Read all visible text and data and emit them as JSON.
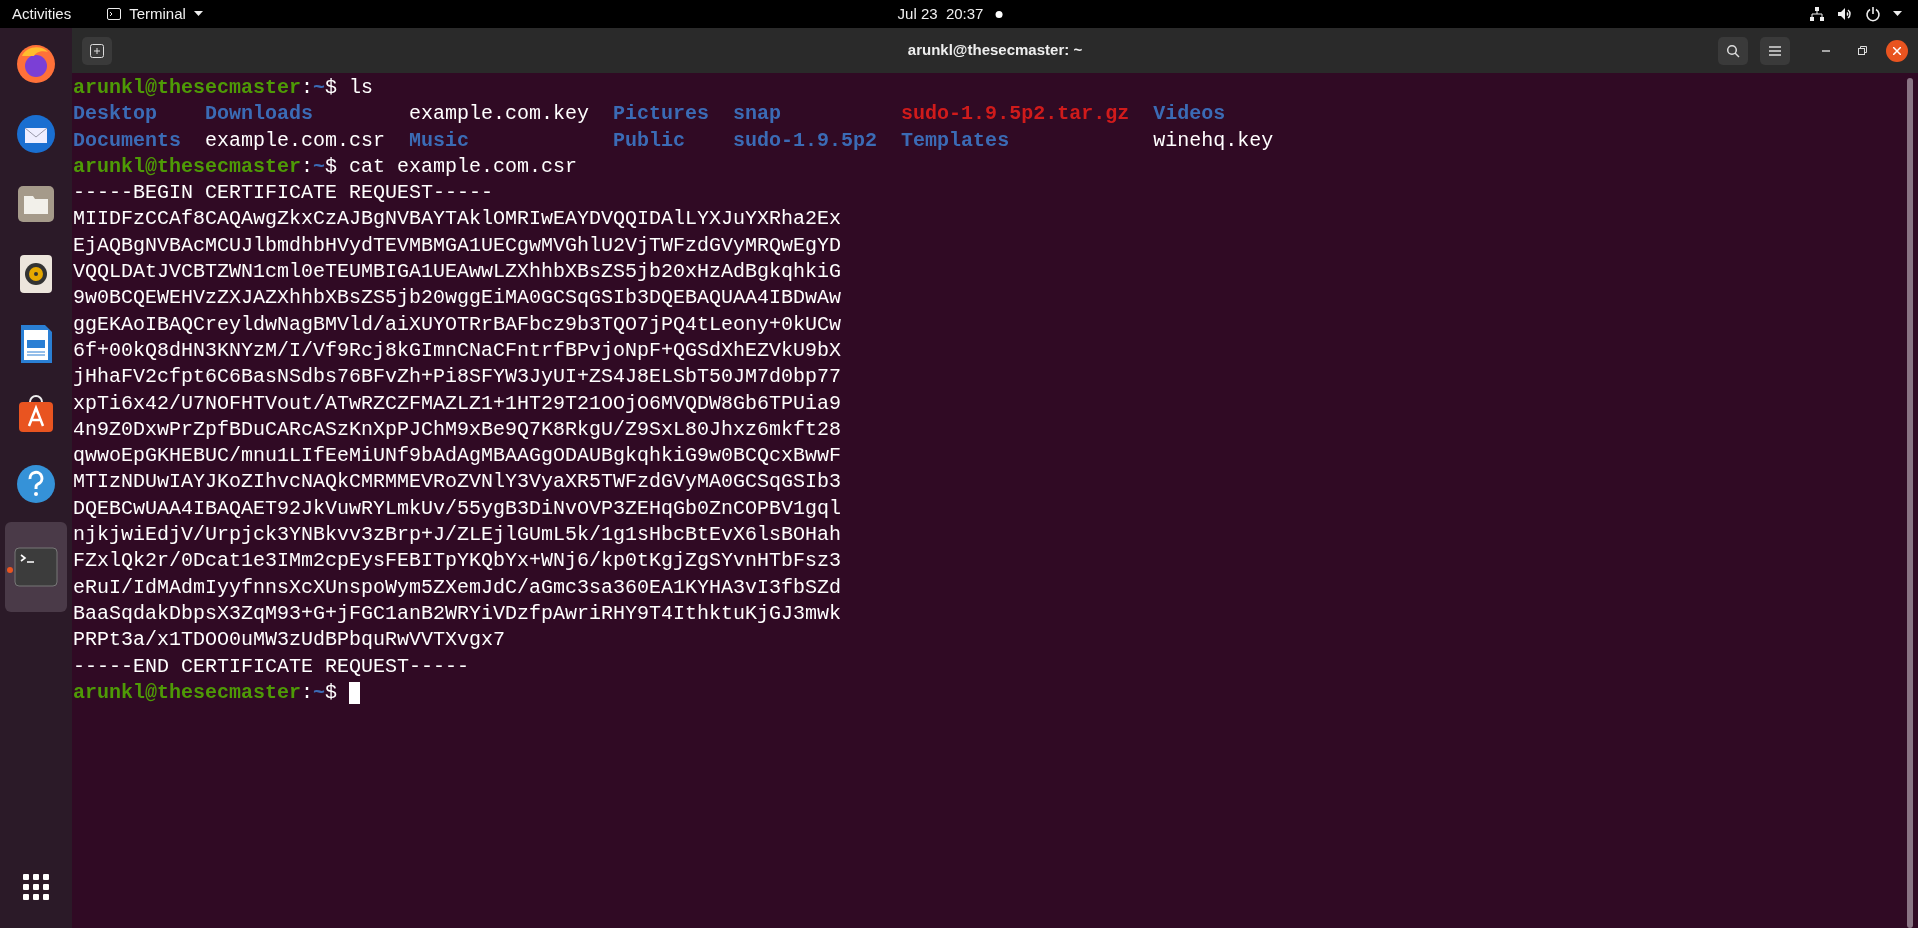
{
  "top_bar": {
    "activities": "Activities",
    "app_menu": "Terminal",
    "clock": "Jul 23  20:37"
  },
  "dock": {
    "items": [
      {
        "kind": "browser",
        "selected": false,
        "running": false
      },
      {
        "kind": "mail",
        "selected": false,
        "running": false
      },
      {
        "kind": "files",
        "selected": false,
        "running": false
      },
      {
        "kind": "music",
        "selected": false,
        "running": false
      },
      {
        "kind": "document",
        "selected": false,
        "running": false
      },
      {
        "kind": "store",
        "selected": false,
        "running": false
      },
      {
        "kind": "help",
        "selected": false,
        "running": false
      },
      {
        "kind": "terminal",
        "selected": true,
        "running": true
      }
    ]
  },
  "window": {
    "title": "arunkl@thesecmaster: ~"
  },
  "terminal": {
    "lines": [
      {
        "kind": "prompt",
        "user": "arunkl@thesecmaster",
        "sep": ":",
        "path": "~",
        "sign": "$",
        "command": "ls"
      },
      {
        "kind": "listing",
        "items": [
          {
            "name": "Desktop",
            "kind": "dir"
          },
          {
            "name": "Downloads",
            "kind": "dir"
          },
          {
            "name": "example.com.key",
            "kind": "file"
          },
          {
            "name": "Pictures",
            "kind": "dir"
          },
          {
            "name": "snap",
            "kind": "dir"
          },
          {
            "name": "sudo-1.9.5p2.tar.gz",
            "kind": "archive"
          },
          {
            "name": "Videos",
            "kind": "dir"
          }
        ]
      },
      {
        "kind": "listing",
        "items": [
          {
            "name": "Documents",
            "kind": "dir"
          },
          {
            "name": "example.com.csr",
            "kind": "file"
          },
          {
            "name": "Music",
            "kind": "dir"
          },
          {
            "name": "Public",
            "kind": "dir"
          },
          {
            "name": "sudo-1.9.5p2",
            "kind": "dir"
          },
          {
            "name": "Templates",
            "kind": "dir"
          },
          {
            "name": "winehq.key",
            "kind": "file"
          }
        ]
      },
      {
        "kind": "prompt",
        "user": "arunkl@thesecmaster",
        "sep": ":",
        "path": "~",
        "sign": "$",
        "command": "cat example.com.csr"
      },
      {
        "kind": "output",
        "text": "-----BEGIN CERTIFICATE REQUEST-----"
      },
      {
        "kind": "output",
        "text": "MIIDFzCCAf8CAQAwgZkxCzAJBgNVBAYTAklOMRIwEAYDVQQIDAlLYXJuYXRha2Ex"
      },
      {
        "kind": "output",
        "text": "EjAQBgNVBAcMCUJlbmdhbHVydTEVMBMGA1UECgwMVGhlU2VjTWFzdGVyMRQwEgYD"
      },
      {
        "kind": "output",
        "text": "VQQLDAtJVCBTZWN1cml0eTEUMBIGA1UEAwwLZXhhbXBsZS5jb20xHzAdBgkqhkiG"
      },
      {
        "kind": "output",
        "text": "9w0BCQEWEHVzZXJAZXhhbXBsZS5jb20wggEiMA0GCSqGSIb3DQEBAQUAA4IBDwAw"
      },
      {
        "kind": "output",
        "text": "ggEKAoIBAQCreyldwNagBMVld/aiXUYOTRrBAFbcz9b3TQO7jPQ4tLeony+0kUCw"
      },
      {
        "kind": "output",
        "text": "6f+00kQ8dHN3KNYzM/I/Vf9Rcj8kGImnCNaCFntrfBPvjoNpF+QGSdXhEZVkU9bX"
      },
      {
        "kind": "output",
        "text": "jHhaFV2cfpt6C6BasNSdbs76BFvZh+Pi8SFYW3JyUI+ZS4J8ELSbT50JM7d0bp77"
      },
      {
        "kind": "output",
        "text": "xpTi6x42/U7NOFHTVout/ATwRZCZFMAZLZ1+1HT29T21OOjO6MVQDW8Gb6TPUia9"
      },
      {
        "kind": "output",
        "text": "4n9Z0DxwPrZpfBDuCARcASzKnXpPJChM9xBe9Q7K8RkgU/Z9SxL80Jhxz6mkft28"
      },
      {
        "kind": "output",
        "text": "qwwoEpGKHEBUC/mnu1LIfEeMiUNf9bAdAgMBAAGgODAUBgkqhkiG9w0BCQcxBwwF"
      },
      {
        "kind": "output",
        "text": "MTIzNDUwIAYJKoZIhvcNAQkCMRMMEVRoZVNlY3VyaXR5TWFzdGVyMA0GCSqGSIb3"
      },
      {
        "kind": "output",
        "text": "DQEBCwUAA4IBAQAET92JkVuwRYLmkUv/55ygB3DiNvOVP3ZEHqGb0ZnCOPBV1gql"
      },
      {
        "kind": "output",
        "text": "njkjwiEdjV/Urpjck3YNBkvv3zBrp+J/ZLEjlGUmL5k/1g1sHbcBtEvX6lsBOHah"
      },
      {
        "kind": "output",
        "text": "FZxlQk2r/0Dcat1e3IMm2cpEysFEBITpYKQbYx+WNj6/kp0tKgjZgSYvnHTbFsz3"
      },
      {
        "kind": "output",
        "text": "eRuI/IdMAdmIyyfnnsXcXUnspoWym5ZXemJdC/aGmc3sa360EA1KYHA3vI3fbSZd"
      },
      {
        "kind": "output",
        "text": "BaaSqdakDbpsX3ZqM93+G+jFGC1anB2WRYiVDzfpAwriRHY9T4IthktuKjGJ3mwk"
      },
      {
        "kind": "output",
        "text": "PRPt3a/x1TDOO0uMW3zUdBPbquRwVVTXvgx7"
      },
      {
        "kind": "output",
        "text": "-----END CERTIFICATE REQUEST-----"
      },
      {
        "kind": "prompt",
        "user": "arunkl@thesecmaster",
        "sep": ":",
        "path": "~",
        "sign": "$",
        "cursor": true
      }
    ]
  }
}
